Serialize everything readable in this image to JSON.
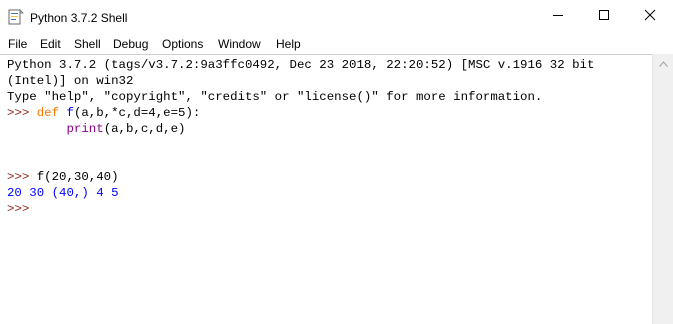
{
  "window": {
    "title": "Python 3.7.2 Shell",
    "icon": "python-idle-icon",
    "controls": [
      "minimize-icon",
      "maximize-icon",
      "close-icon"
    ]
  },
  "menubar": {
    "items": [
      "File",
      "Edit",
      "Shell",
      "Debug",
      "Options",
      "Window",
      "Help"
    ]
  },
  "shell": {
    "banner_line1": "Python 3.7.2 (tags/v3.7.2:9a3ffc0492, Dec 23 2018, 22:20:52) [MSC v.1916 32 bit",
    "banner_line2": "(Intel)] on win32",
    "banner_line3": "Type \"help\", \"copyright\", \"credits\" or \"license()\" for more information.",
    "prompt": ">>>",
    "def_keyword": "def",
    "def_name": "f",
    "def_rest": "(a,b,*c,d=4,e=5):",
    "body_indent": "        ",
    "body_builtin": "print",
    "body_rest": "(a,b,c,d,e)",
    "call_text": "f(20,30,40)",
    "output_line": "20 30 (40,) 4 5"
  },
  "colors": {
    "prompt": "#8b1e1e",
    "keyword": "#ff7700",
    "defname": "#0000ff",
    "builtin": "#900090",
    "output": "#0000ff"
  }
}
